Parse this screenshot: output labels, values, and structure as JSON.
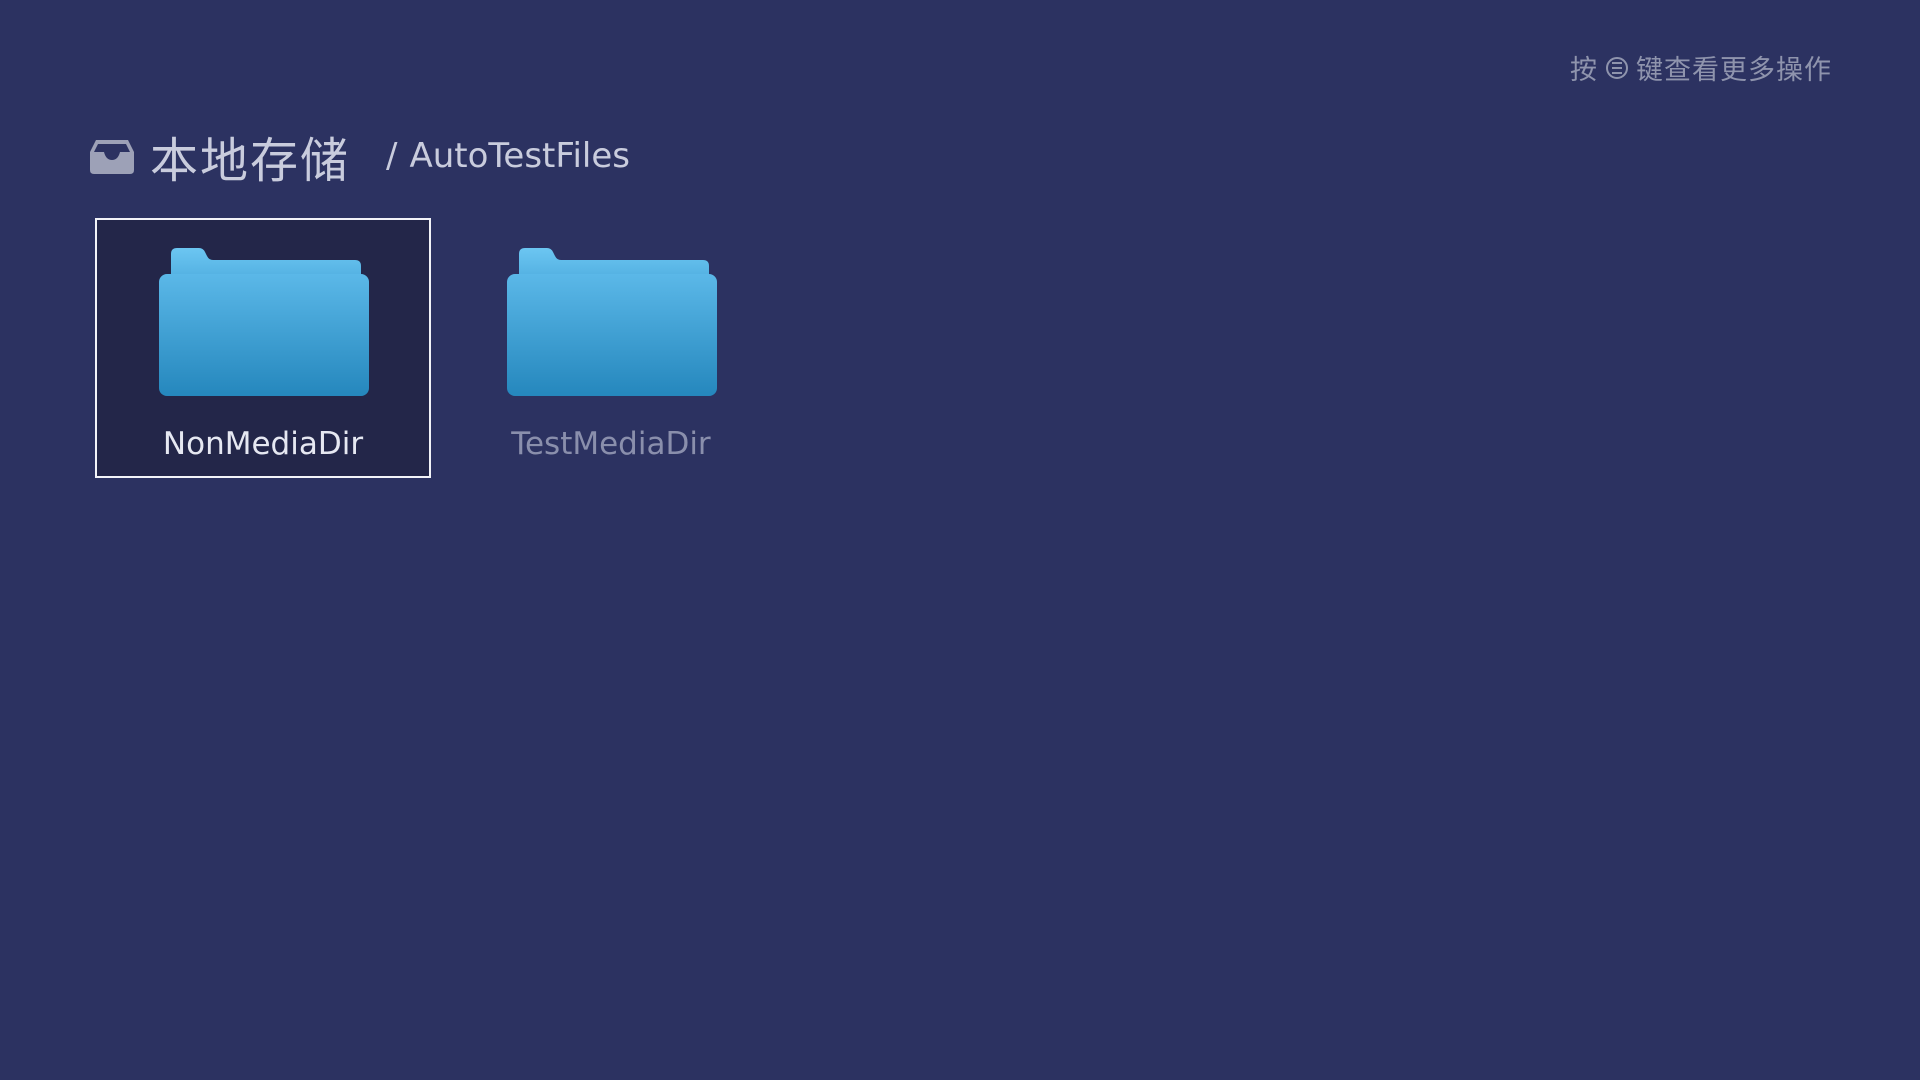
{
  "hint": {
    "prefix": "按",
    "key_icon": "menu-key-icon",
    "suffix": "键查看更多操作"
  },
  "header": {
    "storage_icon": "inbox-tray-icon",
    "title": "本地存储",
    "separator": "/",
    "current_folder": "AutoTestFiles"
  },
  "folders": [
    {
      "name": "NonMediaDir",
      "icon": "folder-icon",
      "selected": true
    },
    {
      "name": "TestMediaDir",
      "icon": "folder-icon",
      "selected": false
    }
  ],
  "colors": {
    "background": "#2c3261",
    "folder_top": "#5bb8e8",
    "folder_bottom": "#2587bd",
    "selection_border": "#f2f3f8"
  }
}
